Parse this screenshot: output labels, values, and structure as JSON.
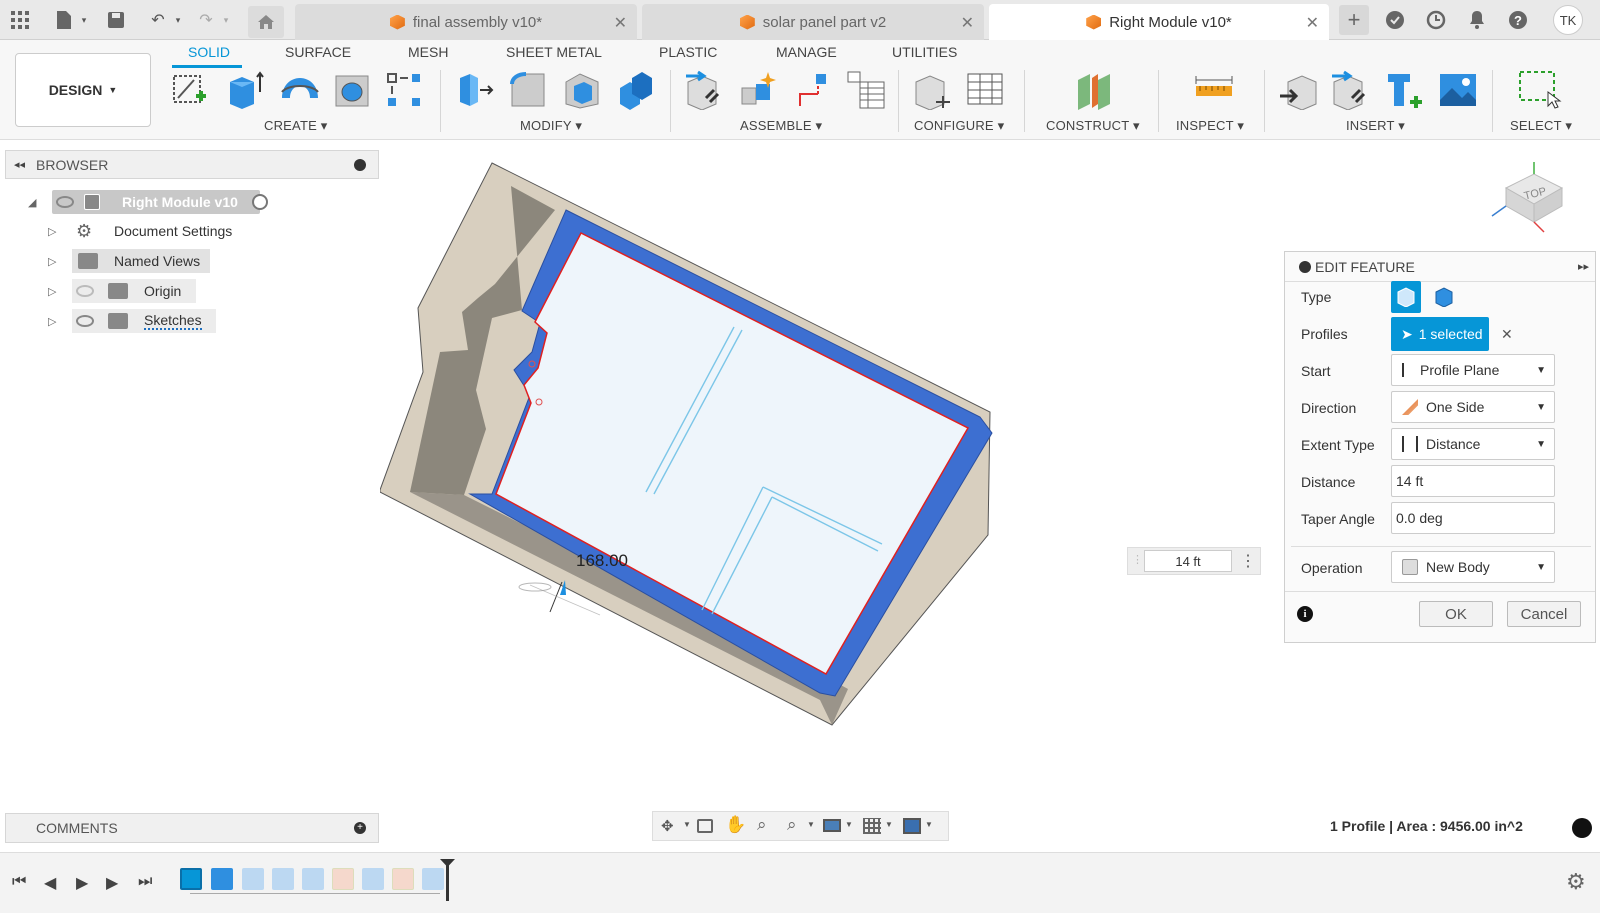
{
  "titlebar": {
    "tabs": [
      {
        "label": "final assembly v10*",
        "active": false
      },
      {
        "label": "solar panel part v2",
        "active": false
      },
      {
        "label": "Right Module v10*",
        "active": true
      }
    ],
    "user_initials": "TK",
    "icons": [
      "grid-icon",
      "file-icon",
      "save-icon",
      "undo-icon",
      "redo-icon",
      "home-icon",
      "plus-icon",
      "extensions-icon",
      "job-status-icon",
      "notifications-icon",
      "help-icon"
    ]
  },
  "ribbon": {
    "workspace": "DESIGN",
    "tabs": [
      "SOLID",
      "SURFACE",
      "MESH",
      "SHEET METAL",
      "PLASTIC",
      "MANAGE",
      "UTILITIES"
    ],
    "active_tab": "SOLID",
    "groups": [
      "CREATE",
      "MODIFY",
      "ASSEMBLE",
      "CONFIGURE",
      "CONSTRUCT",
      "INSPECT",
      "INSERT",
      "SELECT"
    ]
  },
  "browser": {
    "title": "BROWSER",
    "root": "Right Module v10",
    "items": [
      "Document Settings",
      "Named Views",
      "Origin",
      "Sketches"
    ]
  },
  "viewport": {
    "dimension_label": "168.00",
    "distance_input": "14 ft",
    "viewcube_face": "TOP"
  },
  "edit_feature": {
    "title": "EDIT FEATURE",
    "type_label": "Type",
    "profiles_label": "Profiles",
    "profiles_value": "1 selected",
    "start_label": "Start",
    "start_value": "Profile Plane",
    "direction_label": "Direction",
    "direction_value": "One Side",
    "extent_label": "Extent Type",
    "extent_value": "Distance",
    "distance_label": "Distance",
    "distance_value": "14 ft",
    "taper_label": "Taper Angle",
    "taper_value": "0.0 deg",
    "operation_label": "Operation",
    "operation_value": "New Body",
    "ok": "OK",
    "cancel": "Cancel"
  },
  "comments": {
    "title": "COMMENTS"
  },
  "status": {
    "text": "1 Profile | Area : 9456.00 in^2"
  },
  "colors": {
    "accent": "#0696d7",
    "extrude_blue": "#3d6fd1",
    "tan": "#d8cfbf"
  }
}
